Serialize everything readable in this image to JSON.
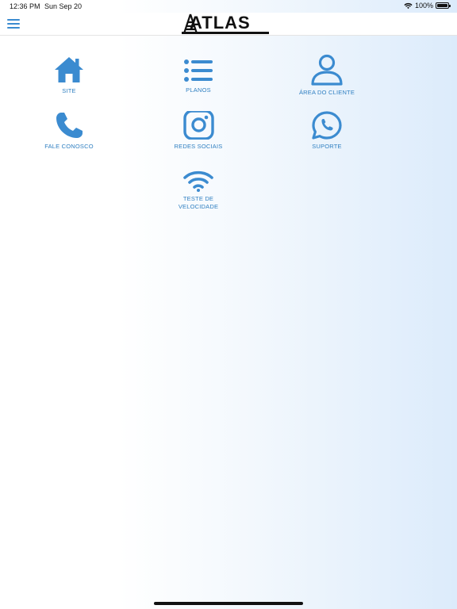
{
  "status_bar": {
    "time": "12:36 PM",
    "date": "Sun Sep 20",
    "battery": "100%"
  },
  "header": {
    "logo_text": "ATLAS"
  },
  "tiles": [
    {
      "label": "SITE",
      "icon": "home-icon"
    },
    {
      "label": "PLANOS",
      "icon": "list-icon"
    },
    {
      "label": "ÁREA DO CLIENTE",
      "icon": "user-icon"
    },
    {
      "label": "FALE CONOSCO",
      "icon": "phone-icon"
    },
    {
      "label": "REDES SOCIAIS",
      "icon": "instagram-icon"
    },
    {
      "label": "SUPORTE",
      "icon": "whatsapp-icon"
    },
    {
      "label": "TESTE DE VELOCIDADE",
      "icon": "wifi-icon"
    }
  ],
  "colors": {
    "accent": "#3b8bd0",
    "label": "#2f7fc1"
  }
}
